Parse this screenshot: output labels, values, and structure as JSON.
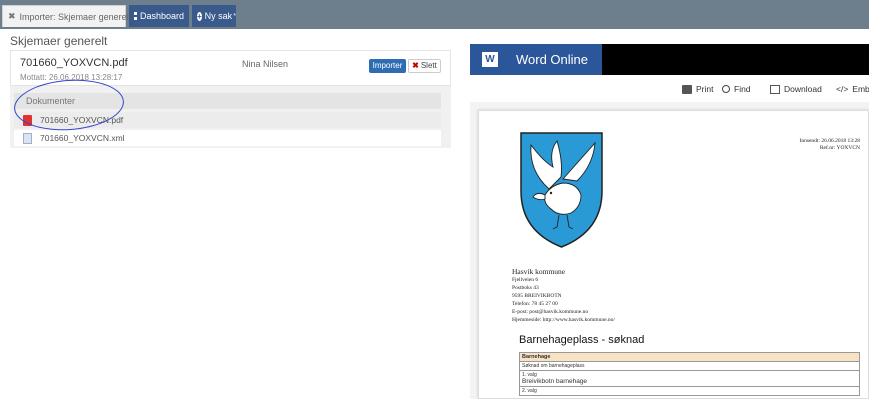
{
  "tabs": [
    {
      "label": "Importer: Skjemaer generelt"
    },
    {
      "label": "Dashboard"
    },
    {
      "label": "Ny sak"
    }
  ],
  "page_title": "Skjemaer generelt",
  "item": {
    "file_name": "701660_YOXVCN.pdf",
    "received": "Mottatt: 26.06.2018 13:28:17",
    "owner": "Nina Nilsen",
    "import_label": "Importer",
    "delete_label": "Slett"
  },
  "documents": {
    "label": "Dokumenter",
    "files": [
      {
        "name": "701660_YOXVCN.pdf",
        "type": "pdf"
      },
      {
        "name": "701660_YOXVCN.xml",
        "type": "xml"
      }
    ]
  },
  "word": {
    "title": "Word Online",
    "toolbar": {
      "print": "Print",
      "find": "Find",
      "download": "Download",
      "embed": "Embe"
    },
    "doc": {
      "meta_line1": "Innsendt: 26.06.2018 13:28",
      "meta_line2": "Ref.nr: YOXVCN",
      "org": "Hasvik kommune",
      "addr1": "Fjellveien 6",
      "addr2": "Postboks 43",
      "addr3": "9595 BREIVIKBOTN",
      "phone": "Telefon: 78 45 27 00",
      "email": "E-post: post@hasvik.kommune.no",
      "web": "Hjemmeside: http://www.hasvik.kommune.no/",
      "heading": "Barnehageplass - søknad",
      "table_header": "Barnehage",
      "row1": "Søknad om barnehageplass",
      "row2_label": "1. valg",
      "row2_value": "Breivikbotn barnehage",
      "row3_label": "2. valg"
    }
  },
  "colors": {
    "accent": "#3a5a8c",
    "word_blue": "#2b579a",
    "tabbar": "#6d7e8d"
  }
}
